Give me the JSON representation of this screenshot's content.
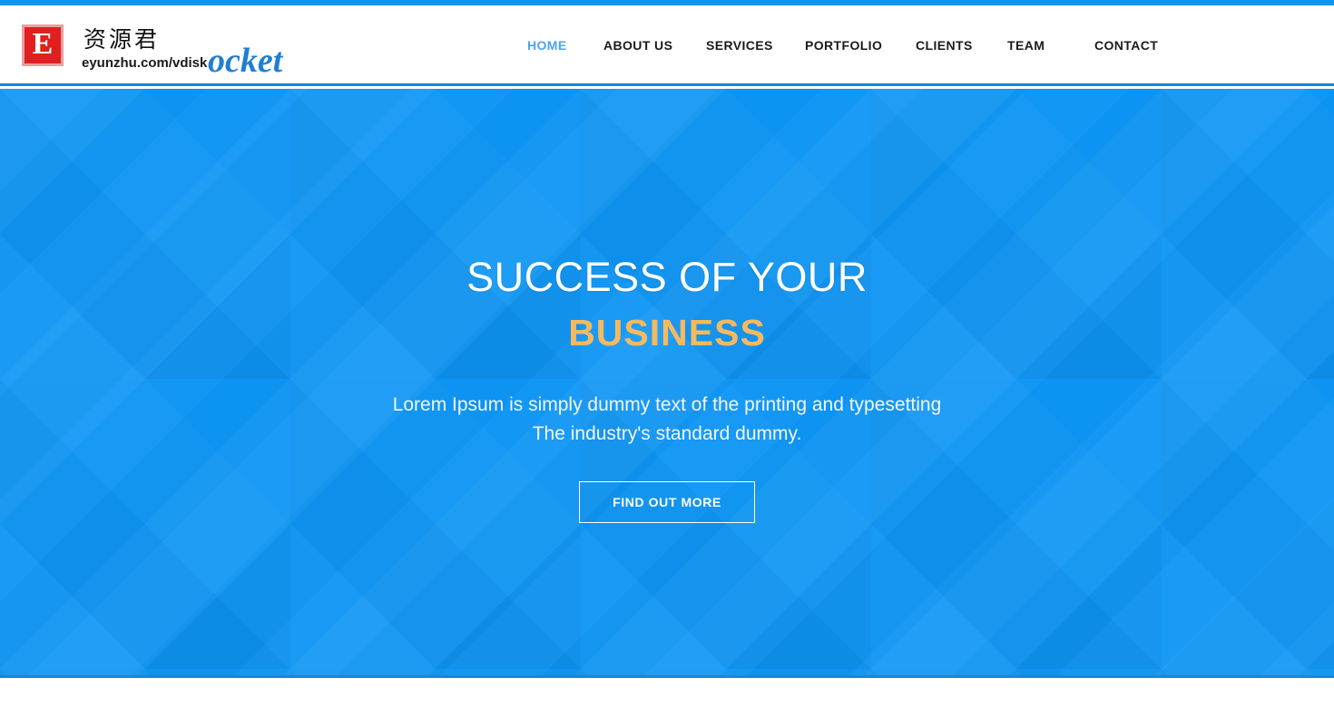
{
  "colors": {
    "accent_blue": "#0d95f5",
    "header_border": "#1787d8",
    "nav_active": "#4aa3f5",
    "highlight_orange": "#f5b95f",
    "logo_red": "#e02020",
    "logo_brand_blue": "#1f7fd4",
    "hero_text": "#ffffff"
  },
  "logo": {
    "mark_letter": "E",
    "chinese_name": "资源君",
    "url": "eyunzhu.com/vdisk",
    "brand_text": "ocket"
  },
  "nav": {
    "items": [
      {
        "label": "HOME",
        "active": true
      },
      {
        "label": "ABOUT US",
        "active": false
      },
      {
        "label": "SERVICES",
        "active": false
      },
      {
        "label": "PORTFOLIO",
        "active": false
      },
      {
        "label": "CLIENTS",
        "active": false
      },
      {
        "label": "TEAM",
        "active": false
      },
      {
        "label": "CONTACT",
        "active": false
      }
    ]
  },
  "hero": {
    "title_line1": "SUCCESS OF YOUR",
    "title_line2": "BUSINESS",
    "subtitle_line1": "Lorem Ipsum is simply dummy text of the printing and typesetting",
    "subtitle_line2": "The industry's standard dummy.",
    "cta_label": "FIND OUT MORE"
  }
}
